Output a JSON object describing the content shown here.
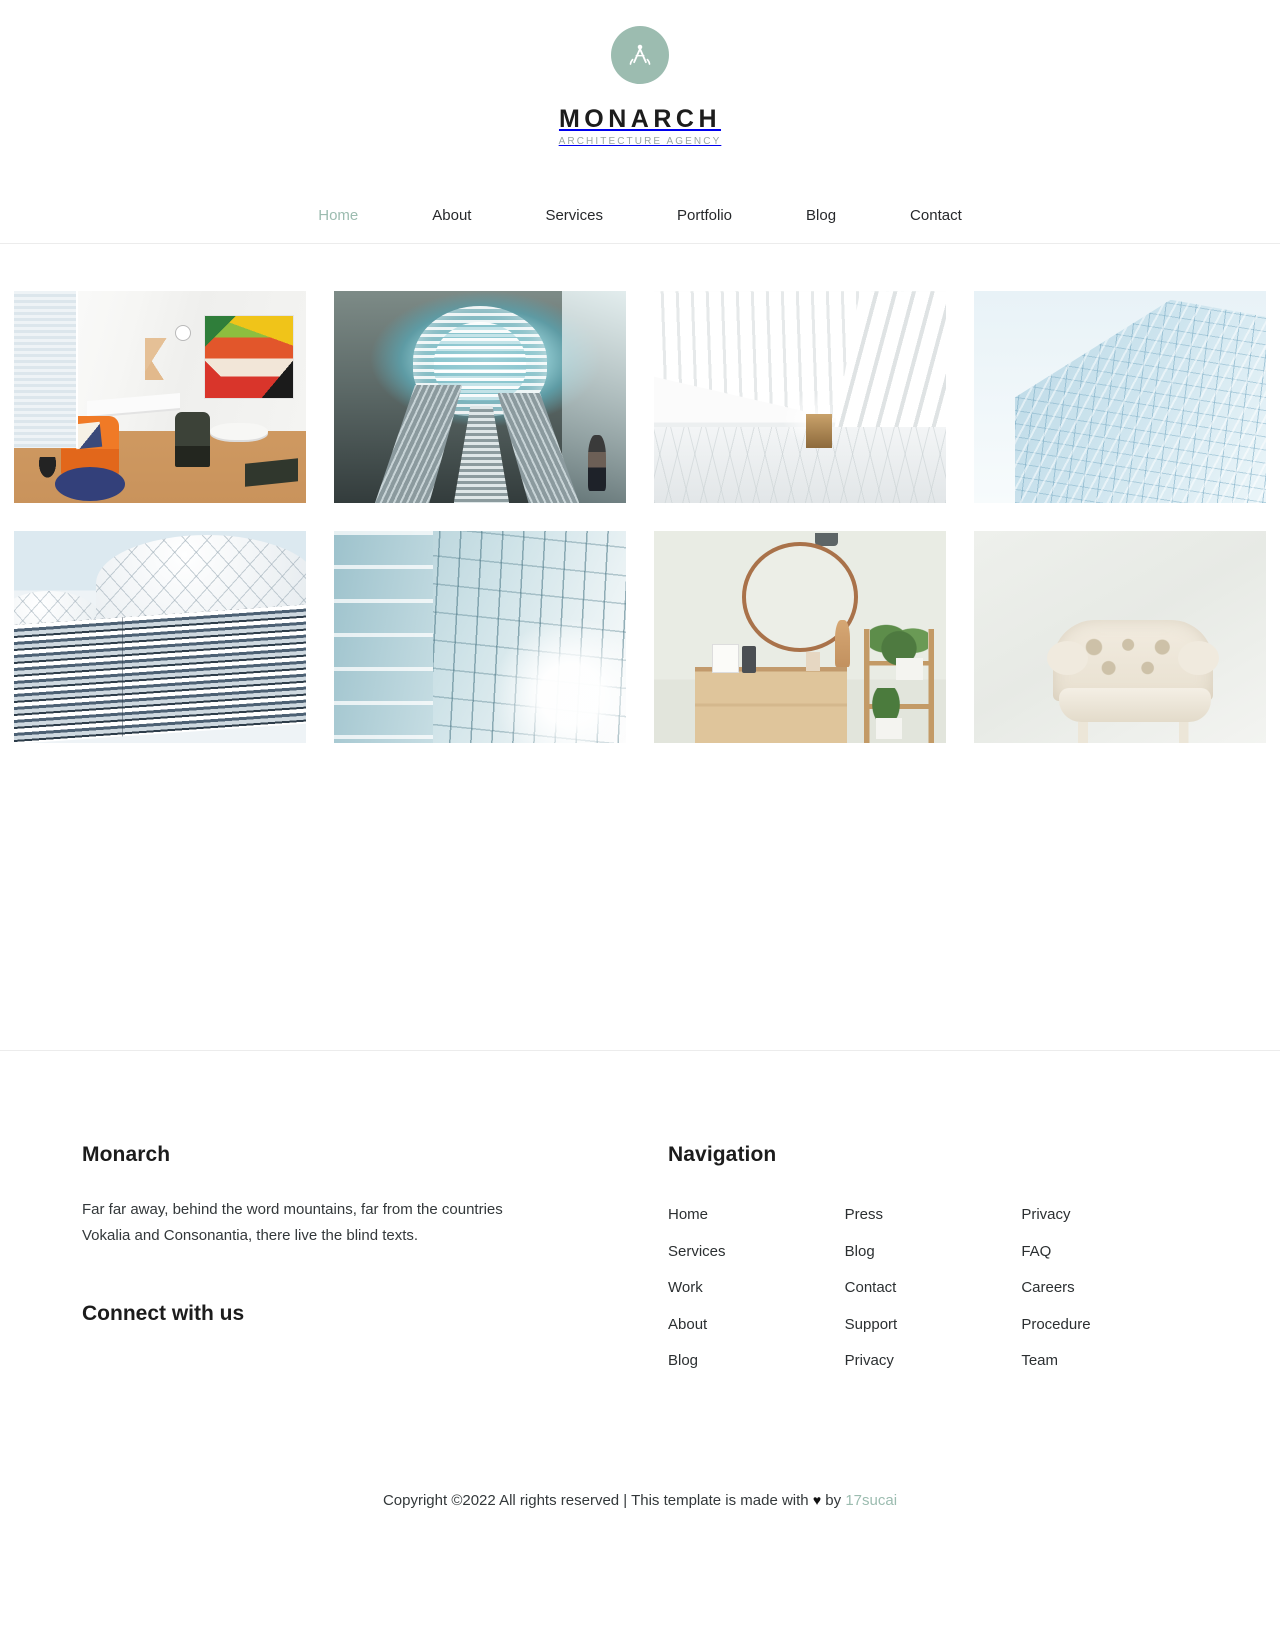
{
  "brand": {
    "logo_icon": "drafting-compass-icon",
    "logo_bg_color": "#9cbcb0",
    "name": "MONARCH",
    "tagline": "ARCHITECTURE AGENCY"
  },
  "nav": {
    "items": [
      {
        "label": "Home",
        "active": true
      },
      {
        "label": "About",
        "active": false
      },
      {
        "label": "Services",
        "active": false
      },
      {
        "label": "Portfolio",
        "active": false
      },
      {
        "label": "Blog",
        "active": false
      },
      {
        "label": "Contact",
        "active": false
      }
    ],
    "active_color": "#9cbcb0"
  },
  "gallery": {
    "items": [
      {
        "alt": "Bright office interior with orange velvet chair, white desks and colorful abstract painting"
      },
      {
        "alt": "Underground station with escalators beneath a vaulted glass barrel ceiling"
      },
      {
        "alt": "White curved ribbed corridor with marble tiled floor"
      },
      {
        "alt": "Pale blue glass curtain wall facade seen from below"
      },
      {
        "alt": "Modern building with white diagrid lattice domes above a striped glass block"
      },
      {
        "alt": "Teal glass facade panels with sun flare at the right"
      },
      {
        "alt": "Scandinavian interior with round wooden mirror, oak dresser, ladder shelf and plants"
      },
      {
        "alt": "Cream tufted armchair on a pale grey-green background"
      }
    ]
  },
  "footer": {
    "about": {
      "heading": "Monarch",
      "text": "Far far away, behind the word mountains, far from the countries Vokalia and Consonantia, there live the blind texts.",
      "connect_heading": "Connect with us"
    },
    "nav": {
      "heading": "Navigation",
      "columns": [
        {
          "links": [
            "Home",
            "Services",
            "Work",
            "About",
            "Blog"
          ]
        },
        {
          "links": [
            "Press",
            "Blog",
            "Contact",
            "Support",
            "Privacy"
          ]
        },
        {
          "links": [
            "Privacy",
            "FAQ",
            "Careers",
            "Procedure",
            "Team"
          ]
        }
      ]
    }
  },
  "copyright": {
    "prefix": "Copyright ©2022 All rights reserved | This template is made with ",
    "heart": "♥",
    "middle": " by ",
    "credit": "17sucai",
    "credit_color": "#9cbcb0"
  }
}
